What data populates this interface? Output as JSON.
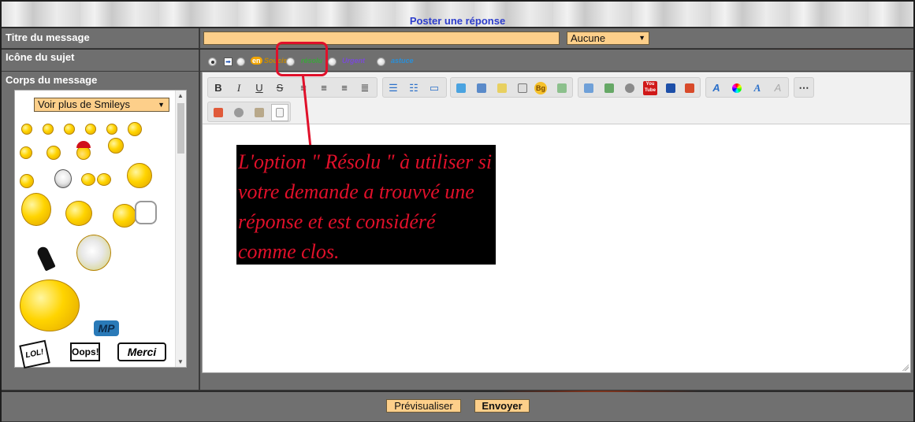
{
  "header": {
    "title": "Poster une réponse"
  },
  "form": {
    "title_label": "Titre du message",
    "title_value": "",
    "color_select": "Aucune",
    "icon_label": "Icône du sujet",
    "icon_options": [
      "Soucis",
      "résolu",
      "Urgent",
      "astuce"
    ],
    "body_label": "Corps du message"
  },
  "smileys": {
    "dropdown": "Voir plus de Smileys",
    "tags": [
      "LOL!",
      "Oops!",
      "Merci",
      "MP"
    ]
  },
  "toolbar": {
    "bold": "B",
    "italic": "I",
    "underline": "U",
    "strike": "S",
    "bg": "Bg",
    "youtube": "You Tube"
  },
  "annotation": {
    "text": "L'option \" Résolu \" à utiliser si votre demande a trouvvé une réponse et est considéré comme clos."
  },
  "footer": {
    "preview_button": "Prévisualiser",
    "submit_button": "Envoyer"
  },
  "colors": {
    "accent": "#fdcf8a",
    "highlight": "#e0102a",
    "header_title": "#2c3ccc"
  }
}
